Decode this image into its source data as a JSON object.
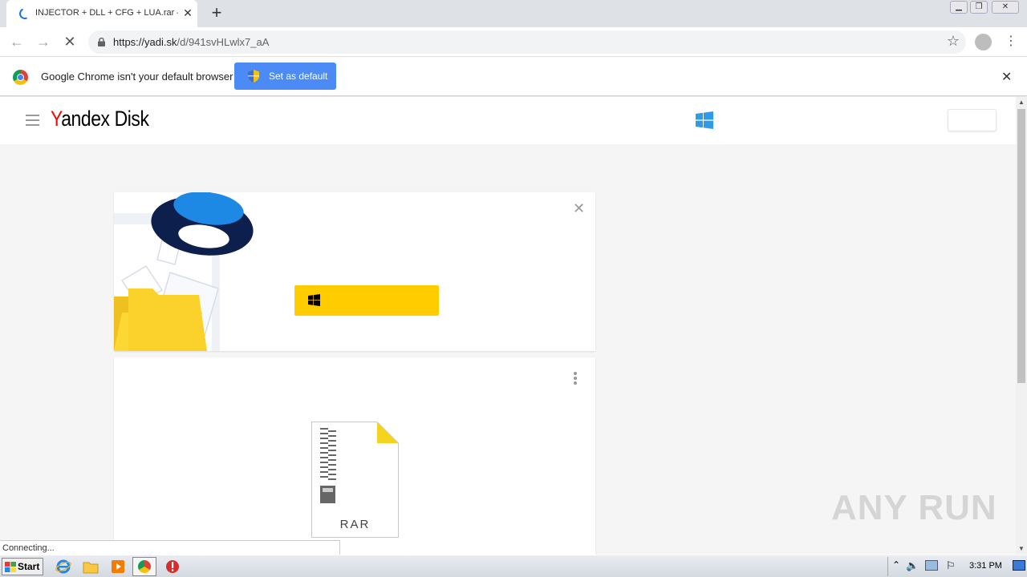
{
  "browser": {
    "tab_title": "INJECTOR + DLL + CFG + LUA.rar –",
    "url_host": "https://yadi.sk",
    "url_path": "/d/941svHLwlx7_aA"
  },
  "infobar": {
    "message": "Google Chrome isn't your default browser",
    "button_label": "Set as default"
  },
  "yandex": {
    "logo_y": "Y",
    "logo_andex": "andex",
    "logo_disk": "Disk"
  },
  "file": {
    "type_label": "RAR"
  },
  "status_bar": {
    "text": "Connecting..."
  },
  "watermark": {
    "text": "ANY RUN"
  },
  "taskbar": {
    "start_label": "Start",
    "clock": "3:31 PM"
  },
  "colors": {
    "accent_blue": "#4c8bf5",
    "yandex_yellow": "#ffcc00",
    "windows_blue": "#2e9be8"
  }
}
